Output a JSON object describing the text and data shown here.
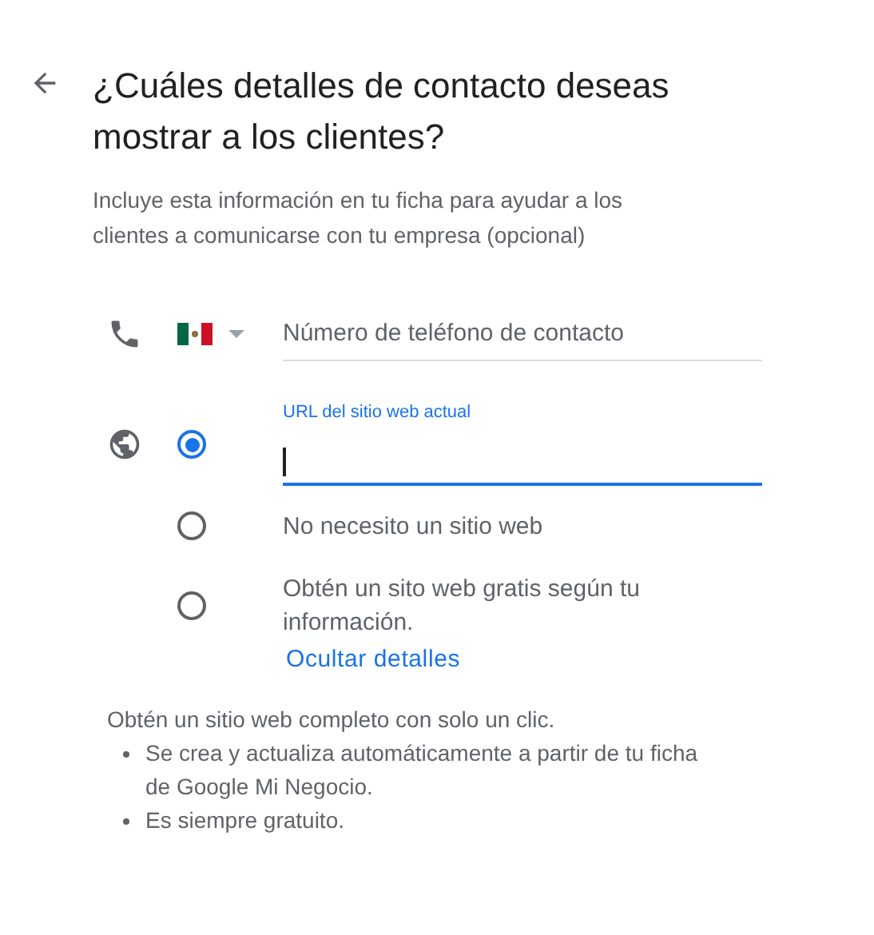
{
  "header": {
    "title": "¿Cuáles detalles de contacto deseas mostrar a los clientes?",
    "subtitle": "Incluye esta información en tu ficha para ayudar a los clientes a comunicarse con tu empresa (opcional)"
  },
  "phone": {
    "placeholder": "Número de teléfono de contacto"
  },
  "website_options": [
    {
      "kind": "field",
      "selected": true,
      "floating_label": "URL del sitio web actual"
    },
    {
      "kind": "text",
      "selected": false,
      "label": "No necesito un sitio web"
    },
    {
      "kind": "text",
      "selected": false,
      "label": "Obtén un sito web gratis según tu información."
    }
  ],
  "details_link": "Ocultar detalles",
  "info": {
    "intro": "Obtén un sitio web completo con solo un clic.",
    "bullets": [
      "Se crea y actualiza automáticamente a partir de tu ficha de Google Mi Negocio.",
      "Es siempre gratuito."
    ]
  }
}
